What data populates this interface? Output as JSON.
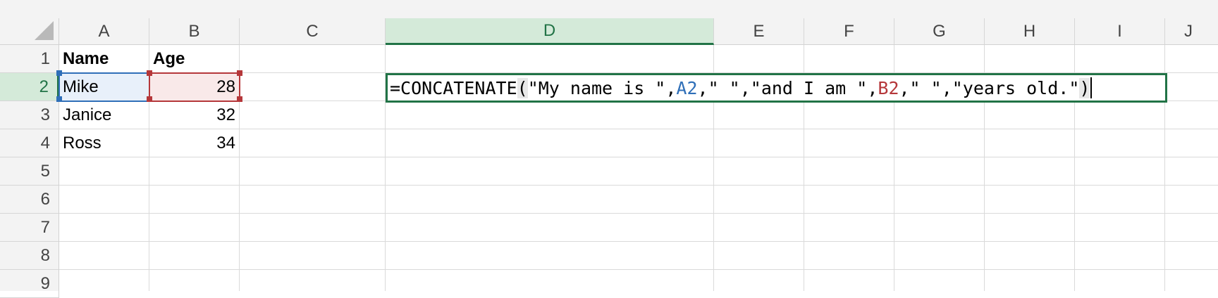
{
  "columns": [
    "A",
    "B",
    "C",
    "D",
    "E",
    "F",
    "G",
    "H",
    "I",
    "J"
  ],
  "selected_column": "D",
  "rows": [
    "1",
    "2",
    "3",
    "4",
    "5",
    "6",
    "7",
    "8",
    "9"
  ],
  "selected_row": "2",
  "cells": {
    "A1": "Name",
    "B1": "Age",
    "A2": "Mike",
    "B2": "28",
    "A3": "Janice",
    "B3": "32",
    "A4": "Ross",
    "B4": "34"
  },
  "active_cell": "D2",
  "formula": {
    "fn": "=CONCATENATE",
    "open_paren": "(",
    "part1": "\"My name is \",",
    "ref1": "A2",
    "part2": ",\" \",\"and I am \",",
    "ref2": "B2",
    "part3": ",\" \",\"years old.\"",
    "close_paren": ")"
  },
  "colors": {
    "selection_green": "#217346",
    "ref_blue": "#2f6fb8",
    "ref_red": "#b5373a"
  }
}
